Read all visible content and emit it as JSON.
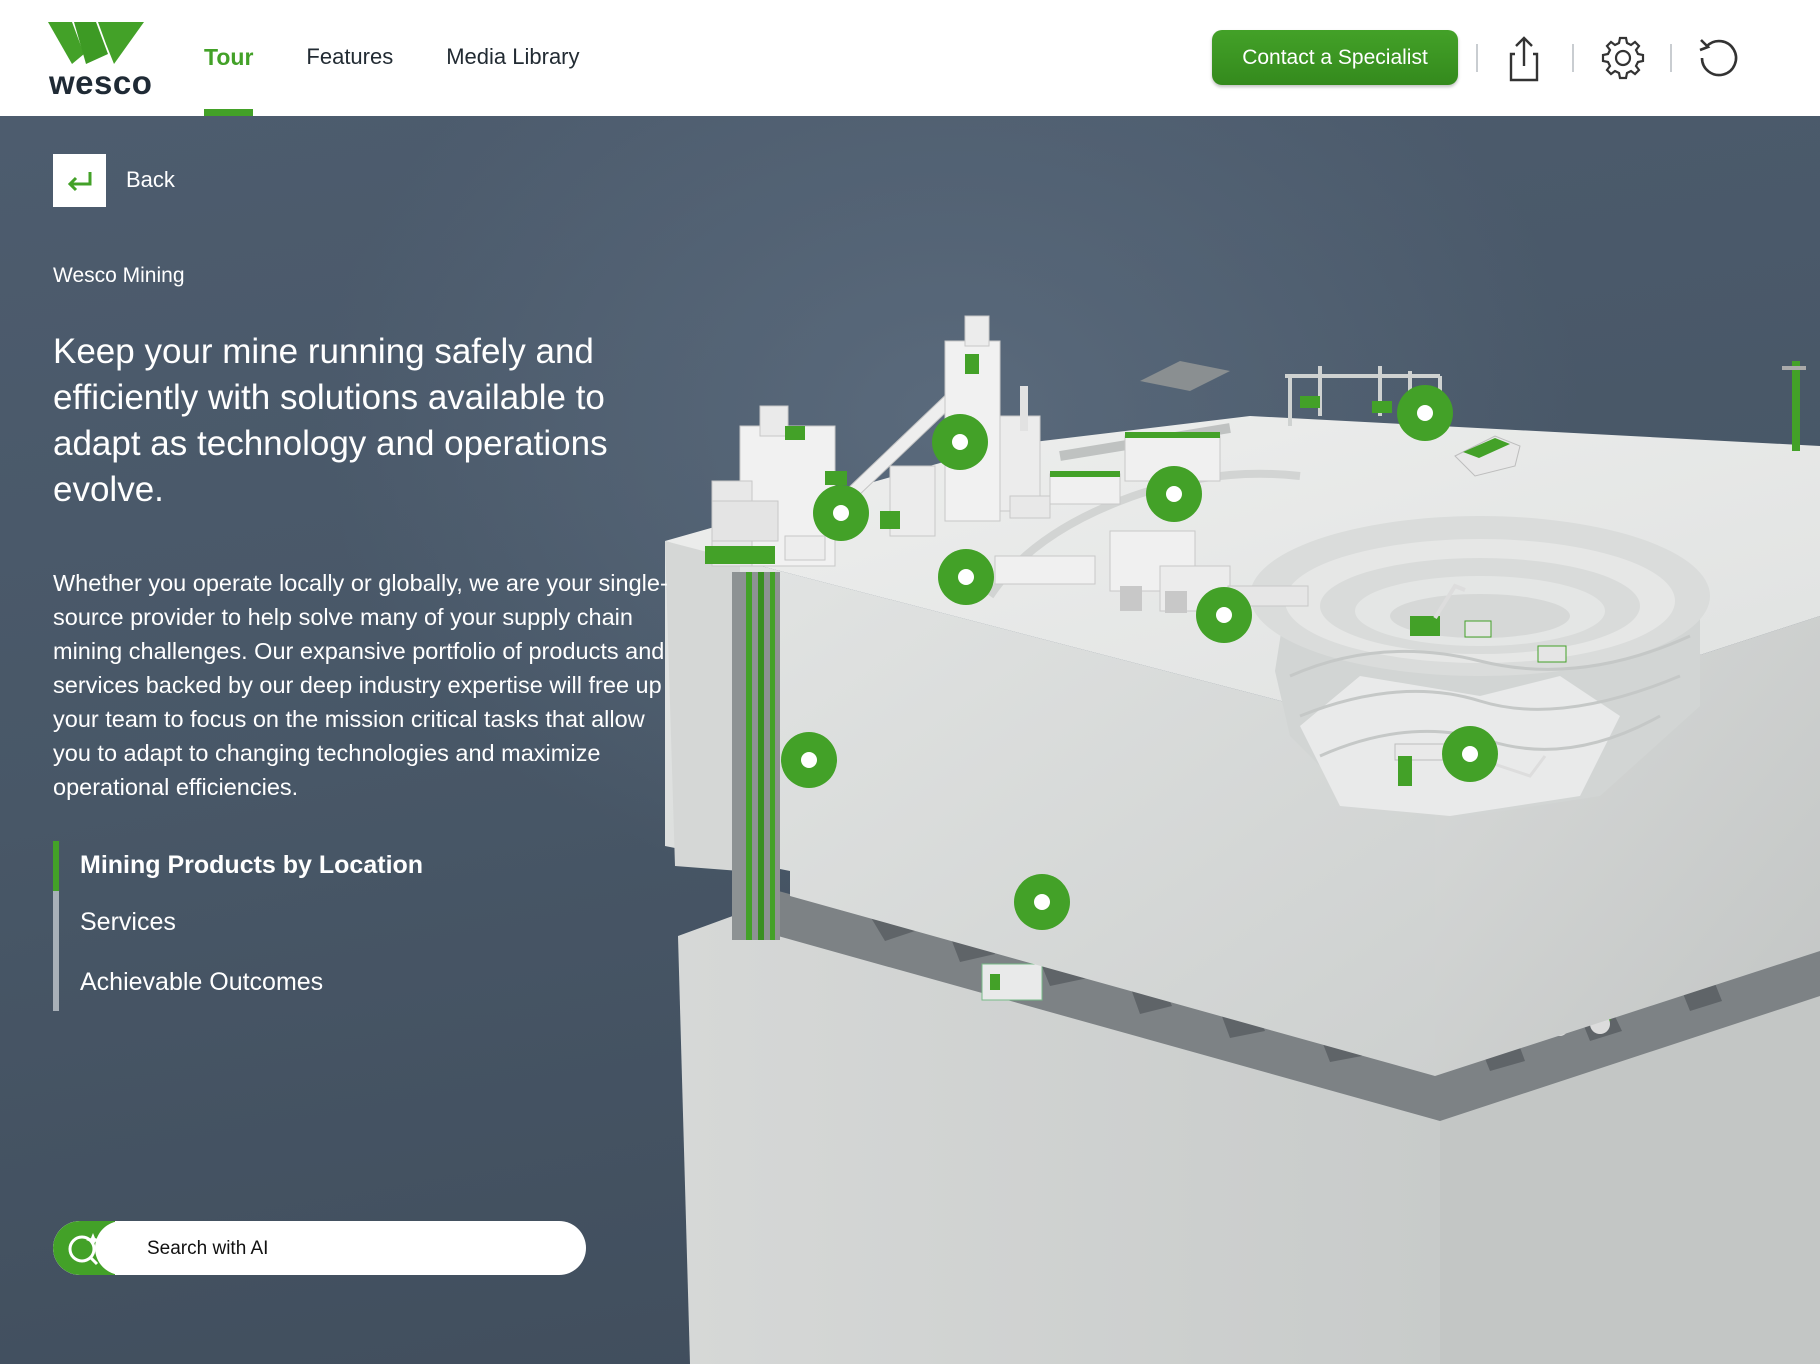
{
  "app": {
    "logo_text": "wesco"
  },
  "nav": {
    "items": [
      {
        "label": "Tour",
        "active": true
      },
      {
        "label": "Features",
        "active": false
      },
      {
        "label": "Media Library",
        "active": false
      }
    ]
  },
  "header": {
    "cta_label": "Contact a Specialist",
    "icons": [
      "share-icon",
      "gear-icon",
      "reset-icon"
    ]
  },
  "content": {
    "back_label": "Back",
    "eyebrow": "Wesco Mining",
    "headline": "Keep your mine running safely and efficiently with solutions available to adapt as technology and operations evolve.",
    "body": "Whether you operate locally or globally, we are your single-source provider to help solve many of your supply chain mining challenges. Our expansive portfolio of products and services backed by our deep industry expertise will free up your team to focus on the mission critical tasks that allow you to adapt to changing technologies and maximize operational efficiencies."
  },
  "sidenav": {
    "items": [
      {
        "label": "Mining Products by Location",
        "active": true
      },
      {
        "label": "Services",
        "active": false
      },
      {
        "label": "Achievable Outcomes",
        "active": false
      }
    ]
  },
  "search": {
    "placeholder": "Search with AI"
  },
  "colors": {
    "brand_green": "#43a128",
    "header_bg": "#ffffff",
    "scene_bg": "#4a5a6c"
  },
  "hotspot_count": 10
}
